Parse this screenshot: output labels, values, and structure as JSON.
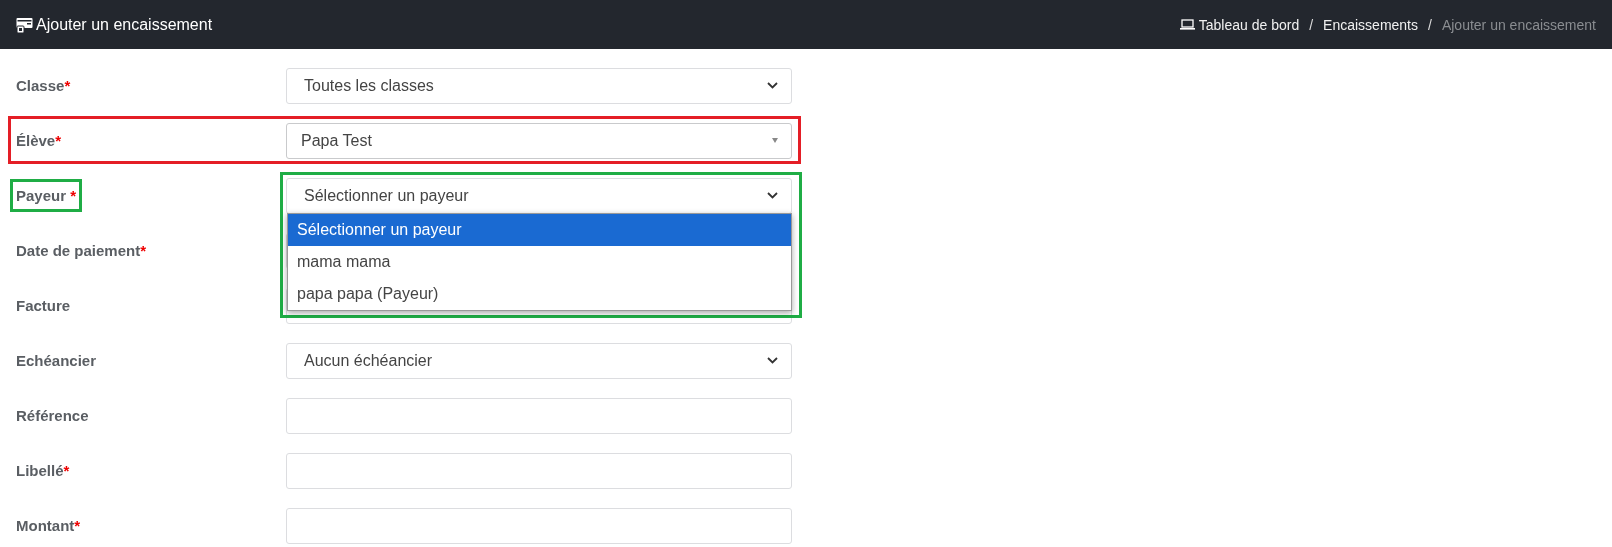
{
  "header": {
    "title": "Ajouter un encaissement",
    "breadcrumb_separator": "/",
    "breadcrumbs": [
      {
        "label": "Tableau de bord",
        "active": false
      },
      {
        "label": "Encaissements",
        "active": false
      },
      {
        "label": "Ajouter un encaissement",
        "active": true
      }
    ]
  },
  "form": {
    "rows": [
      {
        "label": "Classe",
        "required_mark": "*",
        "kind": "select",
        "value": "Toutes les classes"
      },
      {
        "label": "Élève",
        "required_mark": "*",
        "kind": "searchable-select",
        "value": "Papa Test",
        "highlights": [
          {
            "kind": "row",
            "color": "#e41e26"
          }
        ]
      },
      {
        "label": "Payeur ",
        "required_mark": "*",
        "kind": "select",
        "value": "Sélectionner un payeur",
        "highlights": [
          {
            "kind": "label",
            "color": "#1fad45"
          },
          {
            "kind": "control",
            "color": "#1fad45"
          }
        ],
        "open": true,
        "options": [
          {
            "label": "Sélectionner un payeur",
            "selected": true
          },
          {
            "label": "mama mama",
            "selected": false
          },
          {
            "label": "papa papa (Payeur)",
            "selected": false
          }
        ]
      },
      {
        "label": "Date de paiement",
        "required_mark": "*",
        "kind": "input"
      },
      {
        "label": "Facture",
        "kind": "input"
      },
      {
        "label": "Echéancier",
        "kind": "select",
        "value": "Aucun échéancier"
      },
      {
        "label": "Référence",
        "kind": "input"
      },
      {
        "label": "Libellé",
        "required_mark": "*",
        "kind": "input"
      },
      {
        "label": "Montant",
        "required_mark": "*",
        "kind": "input"
      }
    ]
  }
}
